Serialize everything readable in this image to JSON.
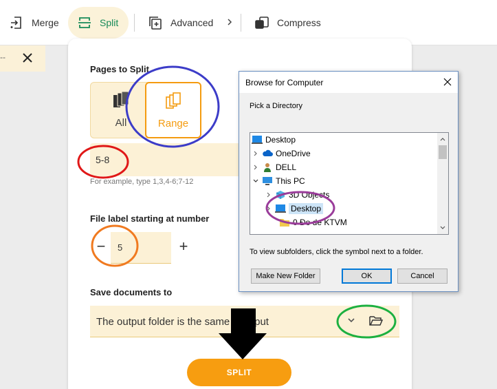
{
  "toolbar": {
    "merge_label": "Merge",
    "split_label": "Split",
    "advanced_label": "Advanced",
    "compress_label": "Compress"
  },
  "left_tab": {
    "text": "--"
  },
  "panel": {
    "pages_to_split_label": "Pages to Split",
    "option_all": "All",
    "option_range": "Range",
    "range_value": "5-8",
    "range_hint": "For example, type 1,3,4-6;7-12",
    "file_label_heading": "File label starting at number",
    "file_label_value": "5",
    "minus_symbol": "−",
    "plus_symbol": "+",
    "save_heading": "Save documents to",
    "save_value": "The output folder is the same as input",
    "split_button": "SPLIT"
  },
  "dialog": {
    "title": "Browse for Computer",
    "prompt": "Pick a Directory",
    "tree": [
      {
        "label": "Desktop",
        "icon": "desktop-icon",
        "expander": ""
      },
      {
        "label": "OneDrive",
        "icon": "cloud-icon",
        "expander": "collapsed"
      },
      {
        "label": "DELL",
        "icon": "user-icon",
        "expander": "collapsed"
      },
      {
        "label": "This PC",
        "icon": "computer-icon",
        "expander": "expanded"
      },
      {
        "label": "3D Objects",
        "icon": "cube-icon",
        "expander": "collapsed"
      },
      {
        "label": "Desktop",
        "icon": "desktop-icon",
        "expander": "collapsed",
        "selected": true
      },
      {
        "label": "0 Đo de KTVM",
        "icon": "folder-icon",
        "expander": ""
      }
    ],
    "note": "To view subfolders, click the symbol next to a folder.",
    "new_folder_button": "Make New Folder",
    "ok_button": "OK",
    "cancel_button": "Cancel"
  },
  "colors": {
    "accent_orange": "#f79d10",
    "split_green": "#168a58",
    "soft_yellow": "#fcf1d6",
    "annotation_blue": "#3c3cc8",
    "annotation_red": "#e01818",
    "annotation_orange": "#f07a20",
    "annotation_purple": "#9a3c9a",
    "annotation_green": "#1cb040"
  }
}
